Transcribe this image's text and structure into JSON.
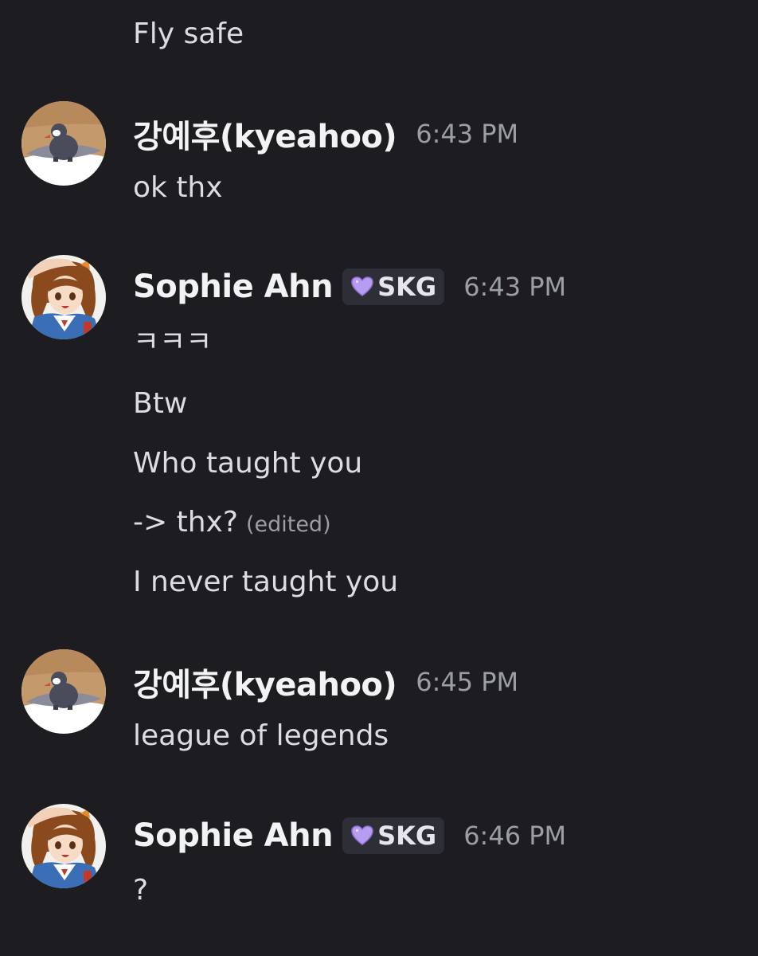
{
  "messages": [
    {
      "continuation_text": "Fly safe"
    },
    {
      "author": "강예후(kyeahoo)",
      "timestamp": "6:43 PM",
      "avatar_icon": "penguin-avatar-icon",
      "lines": [
        "ok thx"
      ]
    },
    {
      "author": "Sophie Ahn",
      "tag": {
        "icon": "purple-heart-icon",
        "label": "SKG"
      },
      "timestamp": "6:43 PM",
      "avatar_icon": "anime-girl-avatar-icon",
      "lines": [
        "ㅋㅋㅋ",
        "Btw",
        "Who taught you",
        "-> thx?",
        "I never taught you"
      ],
      "edited_label": "(edited)"
    },
    {
      "author": "강예후(kyeahoo)",
      "timestamp": "6:45 PM",
      "avatar_icon": "penguin-avatar-icon",
      "lines": [
        "league of legends"
      ]
    },
    {
      "author": "Sophie Ahn",
      "tag": {
        "icon": "purple-heart-icon",
        "label": "SKG"
      },
      "timestamp": "6:46 PM",
      "avatar_icon": "anime-girl-avatar-icon",
      "lines": [
        "?"
      ]
    }
  ],
  "colors": {
    "background": "#1c1c21",
    "author": "#f2f3f5",
    "message_text": "#dcdde2",
    "timestamp": "#9c9ea6",
    "tag_background": "#2e2f36",
    "heart": "#b89cf0"
  }
}
